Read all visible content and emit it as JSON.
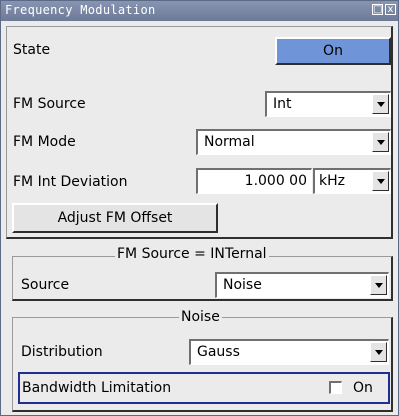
{
  "window": {
    "title": "Frequency Modulation",
    "restore_glyph": "□",
    "close_glyph": "x"
  },
  "state": {
    "label": "State",
    "button": "On"
  },
  "fm_source": {
    "label": "FM Source",
    "value": "Int"
  },
  "fm_mode": {
    "label": "FM Mode",
    "value": "Normal"
  },
  "fm_int_deviation": {
    "label": "FM Int Deviation",
    "value": "1.000 00",
    "unit": "kHz"
  },
  "adjust_button": "Adjust FM Offset",
  "fm_source_group": {
    "title": "FM Source = INTernal",
    "source_label": "Source",
    "source_value": "Noise"
  },
  "noise_group": {
    "title": "Noise",
    "distribution_label": "Distribution",
    "distribution_value": "Gauss",
    "bandwidth_label": "Bandwidth Limitation",
    "bandwidth_checkbox_label": "On",
    "bandwidth_checked": false
  },
  "colors": {
    "titlebar": "#7b88a6",
    "on_button": "#6f94d8",
    "focus_border": "#1e2f8f",
    "background": "#ebebeb"
  }
}
